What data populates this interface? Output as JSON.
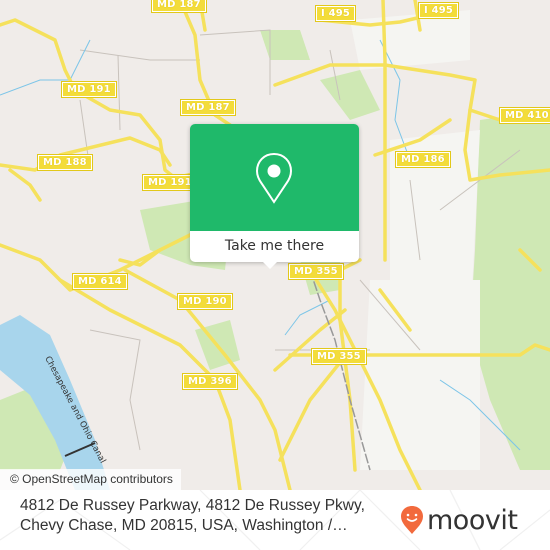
{
  "map": {
    "road_labels": [
      {
        "id": "md187-top",
        "text": "MD 187"
      },
      {
        "id": "i495-left",
        "text": "I 495"
      },
      {
        "id": "i495-right",
        "text": "I 495"
      },
      {
        "id": "md191-a",
        "text": "MD 191"
      },
      {
        "id": "md187-mid",
        "text": "MD 187"
      },
      {
        "id": "md410",
        "text": "MD 410"
      },
      {
        "id": "md188",
        "text": "MD 188"
      },
      {
        "id": "md191-b",
        "text": "MD 191"
      },
      {
        "id": "md186",
        "text": "MD 186"
      },
      {
        "id": "md355-a",
        "text": "MD 355"
      },
      {
        "id": "md614",
        "text": "MD 614"
      },
      {
        "id": "md190",
        "text": "MD 190"
      },
      {
        "id": "md355-b",
        "text": "MD 355"
      },
      {
        "id": "md396",
        "text": "MD 396"
      }
    ],
    "water_label": "Chesapeake and Ohio Canal",
    "attribution": "© OpenStreetMap contributors",
    "colors": {
      "land": "#f0ece9",
      "park": "#cfe8b4",
      "water": "#a8d5ec",
      "road": "#f5e15c"
    }
  },
  "popup": {
    "icon": "map-pin-icon",
    "button_label": "Take me there",
    "accent_color": "#1fb96a"
  },
  "footer": {
    "address_line1": "4812 De Russey Parkway, 4812 De Russey Pkwy,",
    "address_line2": "Chevy Chase, MD 20815, USA, Washington /…",
    "brand": "moovit",
    "brand_color": "#f26a3d"
  }
}
